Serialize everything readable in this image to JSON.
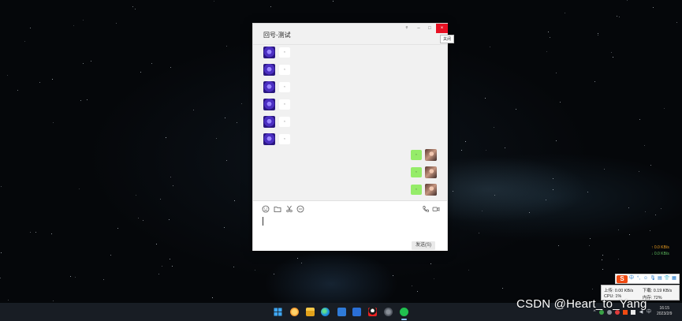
{
  "window": {
    "title": "回号-测试",
    "tooltip": "关闭",
    "buttons": {
      "pin": "ᵠ",
      "minimize": "–",
      "maximize": "□",
      "close": "×"
    }
  },
  "messages": [
    {
      "side": "received",
      "text": ","
    },
    {
      "side": "received",
      "text": ","
    },
    {
      "side": "received",
      "text": ","
    },
    {
      "side": "received",
      "text": ","
    },
    {
      "side": "received",
      "text": ","
    },
    {
      "side": "received",
      "text": ","
    },
    {
      "side": "sent",
      "text": ","
    },
    {
      "side": "sent",
      "text": ","
    },
    {
      "side": "sent",
      "text": ","
    }
  ],
  "toolbar": {
    "icons": [
      "emoji-icon",
      "folder-icon",
      "scissors-icon",
      "chat-history-icon",
      "phone-icon",
      "video-icon"
    ]
  },
  "input": {
    "value": ""
  },
  "send_button": {
    "label": "发送(S)"
  },
  "network": {
    "up": "↑ 0.0 KB/s",
    "down": "↓ 0.0 KB/s"
  },
  "ime": {
    "logo": "S",
    "items": [
      "中",
      "°,",
      "☺",
      "🎙",
      "▤",
      "👕",
      "▦"
    ]
  },
  "monitor": {
    "upload": "上传: 0.00 KB/s",
    "download": "下载: 0.19 KB/s",
    "cpu": "CPU: 1%",
    "memory": "内存: 72%"
  },
  "tray": {
    "ime_label": "中",
    "time": "16:15",
    "date": "2023/2/9"
  },
  "watermark": "CSDN @Heart_to_Yang",
  "colors": {
    "close_red": "#e81123",
    "sent_bubble": "#95ec69",
    "received_bubble": "#ffffff",
    "taskbar": "#181d24"
  }
}
